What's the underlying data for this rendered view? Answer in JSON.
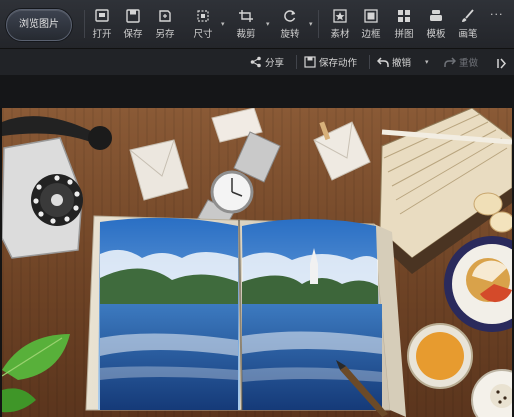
{
  "toolbar": {
    "browse_label": "浏览图片",
    "tools": [
      {
        "label": "打开",
        "icon": "open-icon"
      },
      {
        "label": "保存",
        "icon": "save-icon"
      },
      {
        "label": "另存",
        "icon": "save-as-icon"
      },
      {
        "label": "尺寸",
        "icon": "resize-icon"
      },
      {
        "label": "裁剪",
        "icon": "crop-icon"
      },
      {
        "label": "旋转",
        "icon": "rotate-icon"
      },
      {
        "label": "素材",
        "icon": "material-icon"
      },
      {
        "label": "边框",
        "icon": "border-icon"
      },
      {
        "label": "拼图",
        "icon": "collage-icon"
      },
      {
        "label": "模板",
        "icon": "template-icon"
      },
      {
        "label": "画笔",
        "icon": "brush-icon"
      }
    ],
    "more": "···"
  },
  "actionbar": {
    "share": "分享",
    "save_action": "保存动作",
    "undo": "撤销",
    "redo": "重做"
  },
  "colors": {
    "toolbar_bg": "#2a2d33",
    "actionbar_bg": "#212327",
    "text": "#d8d8d8",
    "disabled": "#6f7278"
  }
}
